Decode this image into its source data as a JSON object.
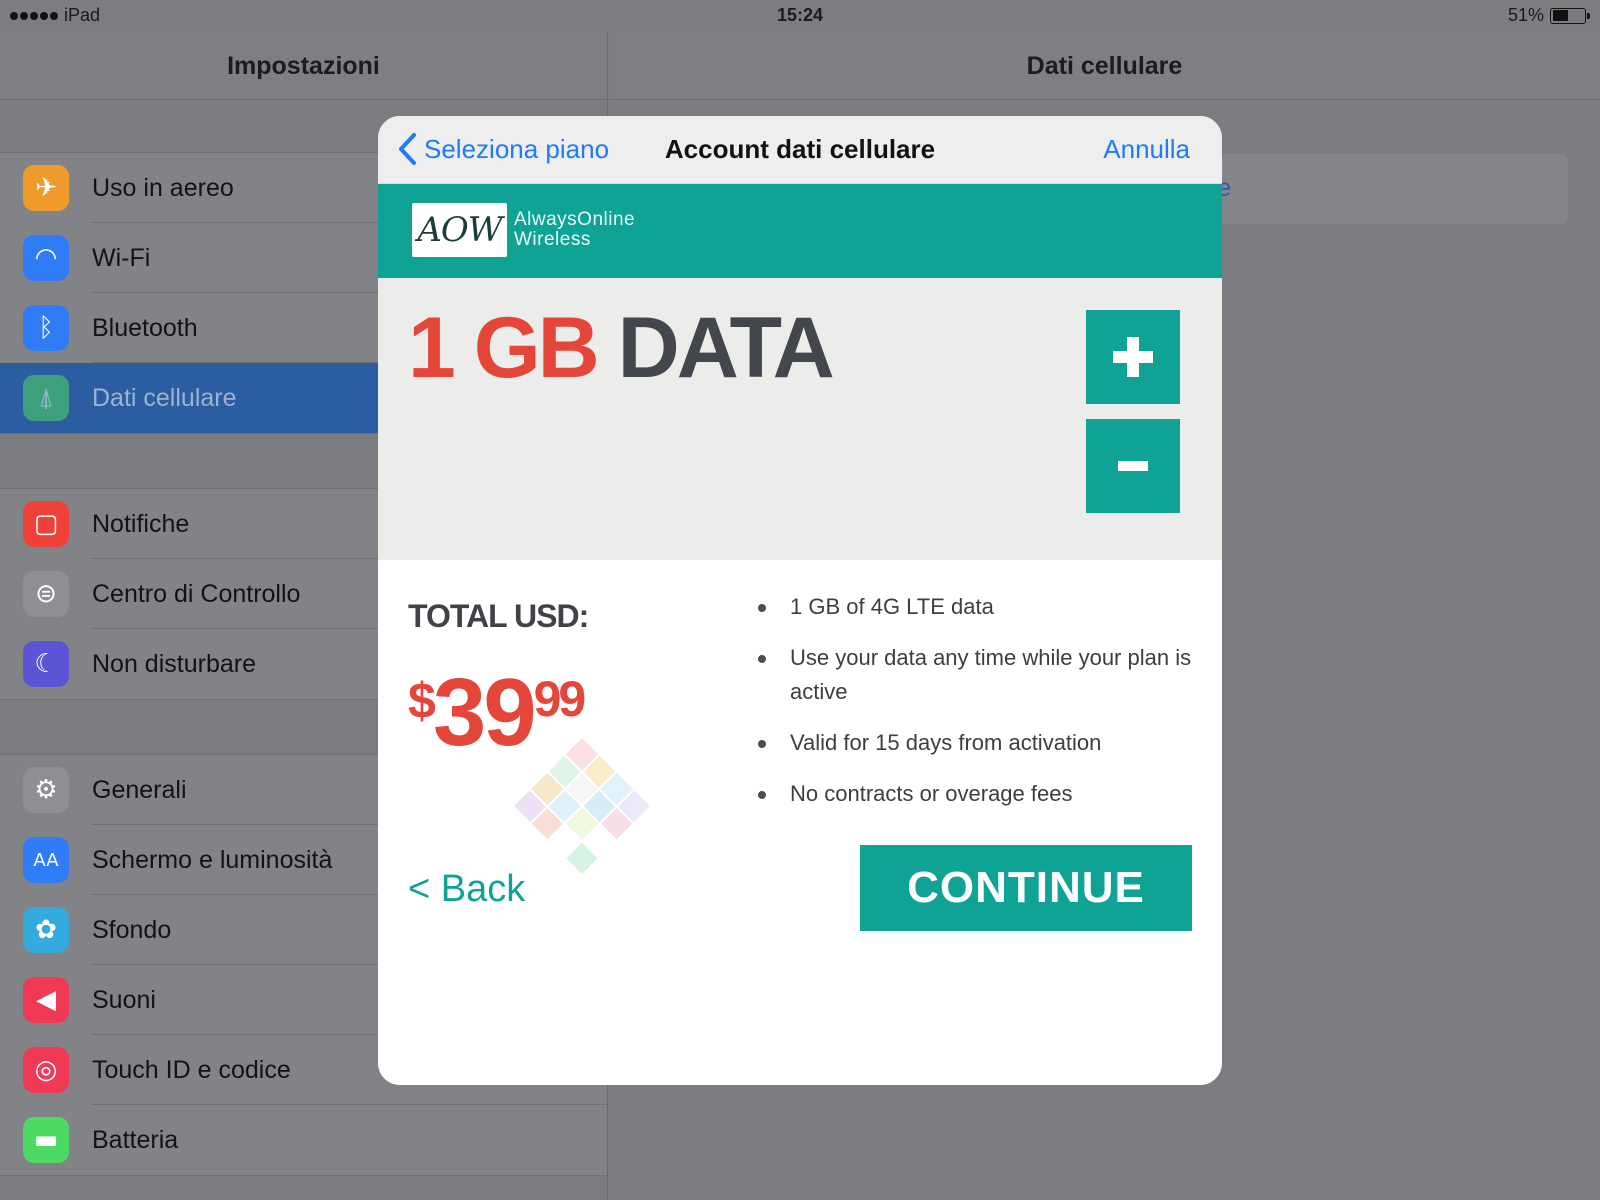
{
  "status_bar": {
    "carrier": "iPad",
    "time": "15:24",
    "battery": "51%",
    "battery_level": 0.51
  },
  "master": {
    "title": "Impostazioni",
    "groups": [
      [
        {
          "label": "Uso in aereo",
          "icon": "airplane-icon",
          "color": "#f19a2c"
        },
        {
          "label": "Wi-Fi",
          "icon": "wifi-icon",
          "color": "#2f7cf6"
        },
        {
          "label": "Bluetooth",
          "icon": "bluetooth-icon",
          "color": "#2f7cf6"
        },
        {
          "label": "Dati cellulare",
          "icon": "antenna-icon",
          "color": "#4cd964",
          "selected": true
        }
      ],
      [
        {
          "label": "Notifiche",
          "icon": "notifications-icon",
          "color": "#f0403a"
        },
        {
          "label": "Centro di Controllo",
          "icon": "control-center-icon",
          "color": "#8e8e93"
        },
        {
          "label": "Non disturbare",
          "icon": "moon-icon",
          "color": "#5b55d6"
        }
      ],
      [
        {
          "label": "Generali",
          "icon": "gear-icon",
          "color": "#8e8e93"
        },
        {
          "label": "Schermo e luminosità",
          "icon": "text-size-icon",
          "color": "#2f7cf6"
        },
        {
          "label": "Sfondo",
          "icon": "flower-icon",
          "color": "#35aadc"
        },
        {
          "label": "Suoni",
          "icon": "speaker-icon",
          "color": "#f03a55"
        },
        {
          "label": "Touch ID e codice",
          "icon": "fingerprint-icon",
          "color": "#f03a55"
        },
        {
          "label": "Batteria",
          "icon": "battery-icon",
          "color": "#4cd964"
        }
      ]
    ]
  },
  "detail": {
    "title": "Dati cellulare",
    "partial_link": "re"
  },
  "modal": {
    "back_label": "Seleziona piano",
    "title": "Account dati cellulare",
    "cancel_label": "Annulla",
    "brand": {
      "logo": "AOW",
      "line1": "AlwaysOnline",
      "line2": "Wireless",
      "color": "#0fa396"
    },
    "plan": {
      "amount": "1 GB",
      "word": "DATA",
      "plus": "+",
      "minus": "−"
    },
    "total_label": "TOTAL USD:",
    "price": {
      "currency": "$",
      "whole": "39",
      "cents": "99"
    },
    "features": [
      "1 GB of 4G LTE data",
      "Use your data any time while your plan is active",
      "Valid for 15 days from activation",
      "No contracts or overage fees"
    ],
    "back_link": "< Back",
    "continue_label": "CONTINUE"
  },
  "colors": {
    "accent": "#0fa396",
    "price_red": "#e4473a",
    "ios_blue": "#1f7bf6"
  }
}
